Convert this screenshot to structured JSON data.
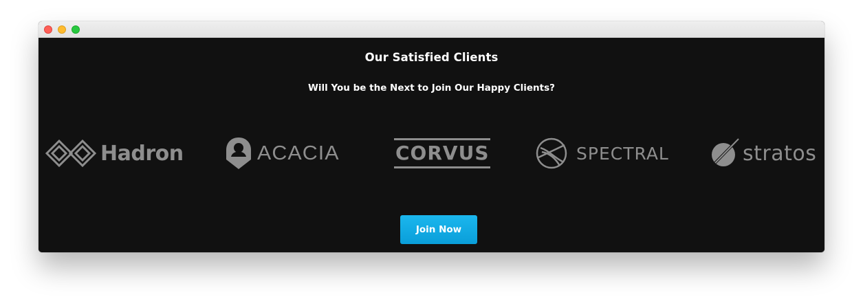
{
  "section": {
    "heading": "Our Satisfied Clients",
    "subheading": "Will You be the Next to Join Our Happy Clients?"
  },
  "logos": [
    {
      "name": "Hadron",
      "icon": "hadron-logo-icon"
    },
    {
      "name": "ACACIA",
      "icon": "acacia-logo-icon"
    },
    {
      "name": "CORVUS",
      "icon": "corvus-logo-icon"
    },
    {
      "name": "SPECTRAL",
      "icon": "spectral-logo-icon"
    },
    {
      "name": "stratos",
      "icon": "stratos-logo-icon"
    }
  ],
  "cta": {
    "label": "Join Now"
  },
  "colors": {
    "background": "#111111",
    "logo": "#8e8e8e",
    "button": "#12aae4",
    "text": "#ffffff"
  }
}
